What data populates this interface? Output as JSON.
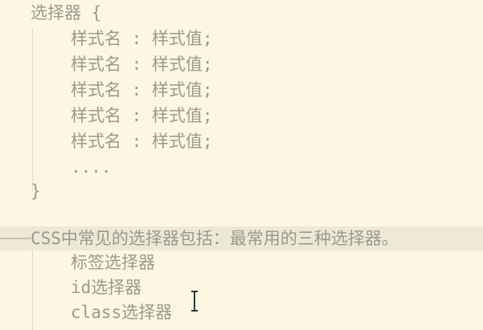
{
  "code": {
    "selector_open": "选择器 {",
    "rules": [
      "样式名 : 样式值;",
      "样式名 : 样式值;",
      "样式名 : 样式值;",
      "样式名 : 样式值;",
      "样式名 : 样式值;"
    ],
    "ellipsis": "....",
    "close_brace": "}",
    "note": "CSS中常见的选择器包括：最常用的三种选择器。",
    "selector_types": [
      "标签选择器",
      "id选择器",
      "class选择器"
    ]
  },
  "colors": {
    "background": "#fdf6e3",
    "text": "#9a9a8c",
    "current_line": "#eee8d6"
  }
}
